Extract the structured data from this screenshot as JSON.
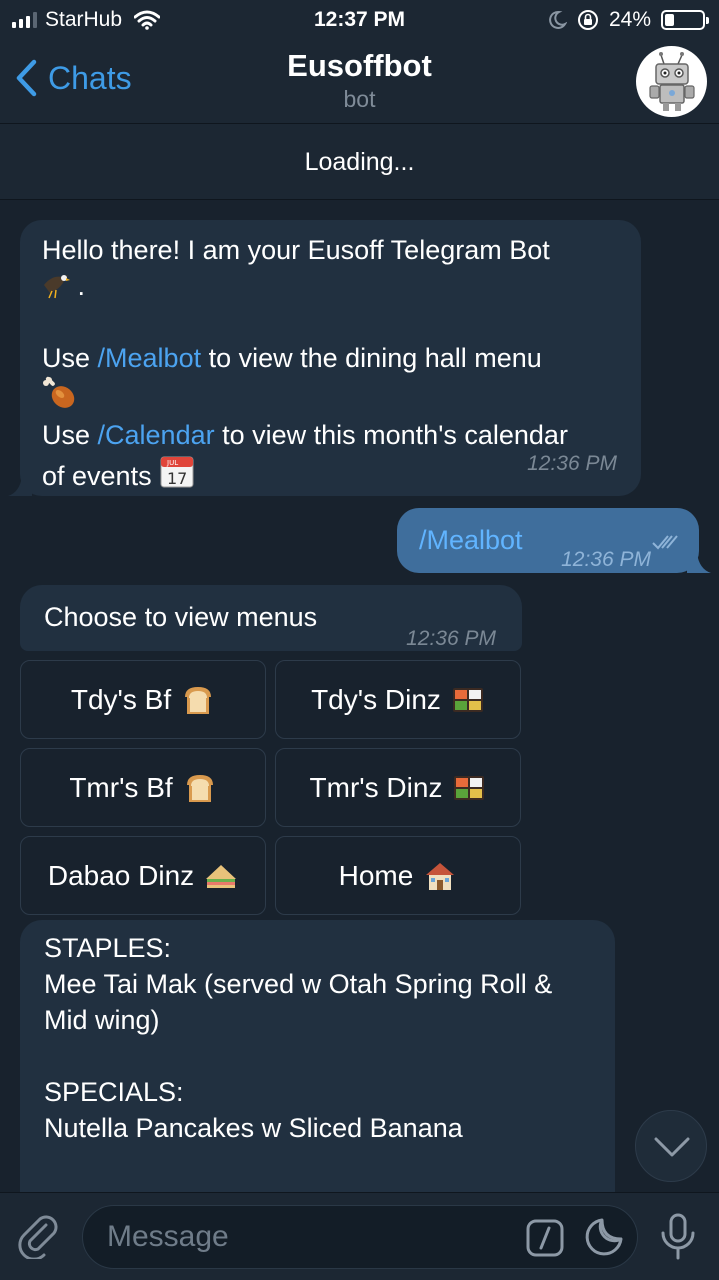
{
  "status_bar": {
    "carrier": "StarHub",
    "time": "12:37 PM",
    "battery_percent": "24%",
    "battery_level": 0.24
  },
  "nav": {
    "back_label": "Chats",
    "title": "Eusoffbot",
    "subtitle": "bot"
  },
  "pinned": {
    "text": "Loading..."
  },
  "messages": [
    {
      "line1": "Hello there! I am your Eusoff Telegram Bot",
      "line2_end": ".",
      "use1_prefix": "Use ",
      "use1_cmd": "/Mealbot",
      "use1_suffix": " to view the dining hall menu",
      "use2_prefix": "Use ",
      "use2_cmd": "/Calendar",
      "use2_suffix": " to view this month's calendar",
      "line_events": "of events",
      "time": "12:36 PM"
    },
    {
      "text": "/Mealbot",
      "time": "12:36 PM"
    },
    {
      "text": "Choose to view menus",
      "time": "12:36 PM"
    },
    {
      "l1": "STAPLES:",
      "l2": "Mee Tai Mak (served w Otah Spring Roll &",
      "l3": "Mid wing)",
      "l4": "SPECIALS:",
      "l5": "Nutella Pancakes w Sliced Banana"
    }
  ],
  "keyboard": [
    {
      "label": "Tdy's Bf",
      "icon": "bread-icon"
    },
    {
      "label": "Tdy's Dinz",
      "icon": "bento-icon"
    },
    {
      "label": "Tmr's Bf",
      "icon": "bread-icon"
    },
    {
      "label": "Tmr's Dinz",
      "icon": "bento-icon"
    },
    {
      "label": "Dabao Dinz",
      "icon": "sandwich-icon"
    },
    {
      "label": "Home",
      "icon": "house-icon"
    }
  ],
  "input": {
    "placeholder": "Message"
  },
  "colors": {
    "background": "#18222d",
    "bubble_in": "#213040",
    "bubble_out": "#3f6e9c",
    "link": "#4ca3f0",
    "accent": "#3e9be6"
  }
}
